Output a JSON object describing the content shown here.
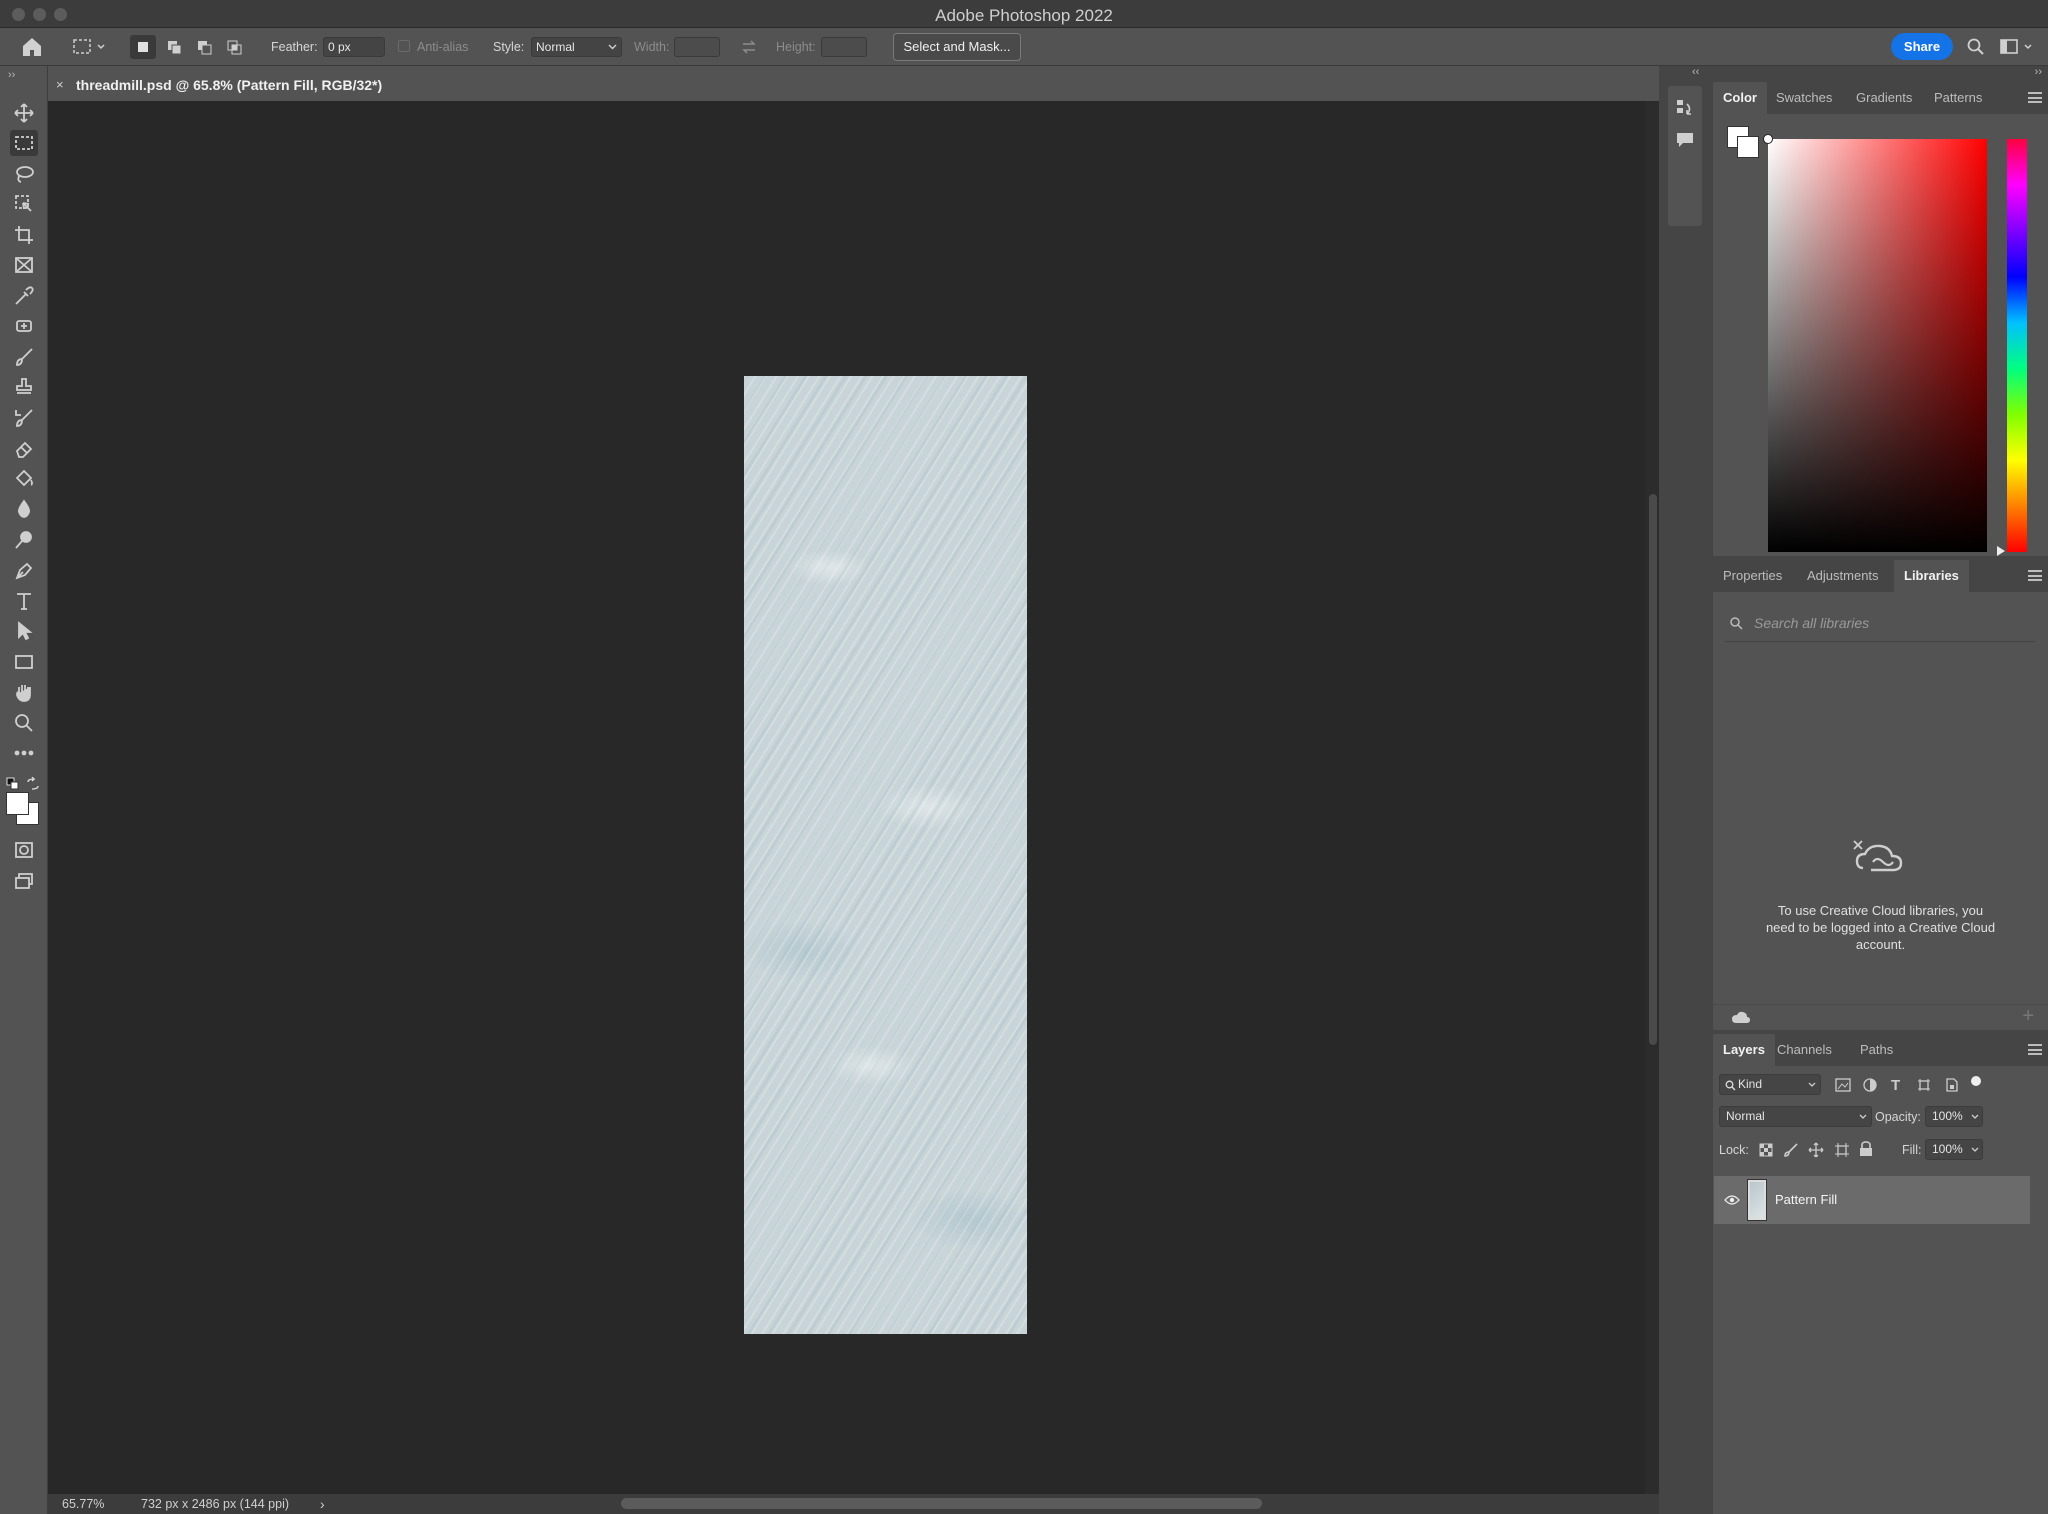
{
  "app_title": "Adobe Photoshop 2022",
  "options_bar": {
    "feather_label": "Feather:",
    "feather_value": "0 px",
    "antialias_label": "Anti-alias",
    "style_label": "Style:",
    "style_value": "Normal",
    "width_label": "Width:",
    "height_label": "Height:",
    "select_mask_label": "Select and Mask...",
    "share_label": "Share"
  },
  "document_tab": {
    "close": "×",
    "title": "threadmill.psd @ 65.8% (Pattern Fill, RGB/32*)"
  },
  "status_bar": {
    "zoom": "65.77%",
    "info": "732 px x 2486 px (144 ppi)",
    "arrow": "›"
  },
  "color_panel": {
    "tabs": [
      "Color",
      "Swatches",
      "Gradients",
      "Patterns"
    ],
    "active_tab": "Color"
  },
  "libraries_panel": {
    "tabs": [
      "Properties",
      "Adjustments",
      "Libraries"
    ],
    "active_tab": "Libraries",
    "search_placeholder": "Search all libraries",
    "message": "To use Creative Cloud libraries, you need to be logged into a Creative Cloud account."
  },
  "layers_panel": {
    "tabs": [
      "Layers",
      "Channels",
      "Paths"
    ],
    "active_tab": "Layers",
    "filter_value": "Kind",
    "blend_mode": "Normal",
    "opacity_label": "Opacity:",
    "opacity_value": "100%",
    "lock_label": "Lock:",
    "fill_label": "Fill:",
    "fill_value": "100%",
    "layers": [
      {
        "name": "Pattern Fill",
        "visible": true
      }
    ]
  },
  "colors": {
    "accent": "#1473e6",
    "panel_bg": "#535353",
    "canvas_bg": "#282828"
  },
  "icons": [
    "home-icon",
    "marquee-icon",
    "move-icon",
    "lasso-icon",
    "crop-icon",
    "eyedropper-icon",
    "brush-icon",
    "stamp-icon",
    "eraser-icon",
    "bucket-icon",
    "pen-icon",
    "type-icon",
    "hand-icon",
    "zoom-icon",
    "search-icon",
    "eye-icon",
    "cloud-icon",
    "lock-icon"
  ]
}
